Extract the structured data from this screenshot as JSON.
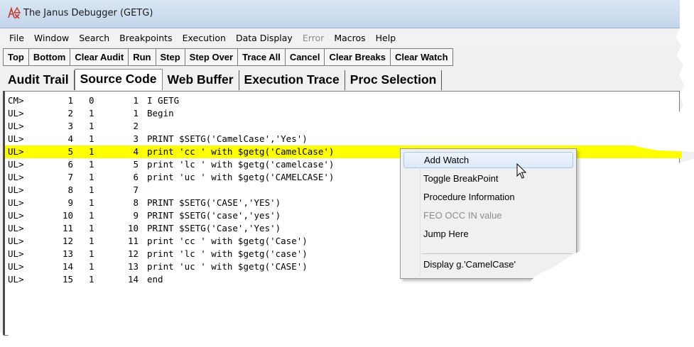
{
  "window": {
    "title": "The Janus Debugger (GETG)"
  },
  "menu": [
    "File",
    "Window",
    "Search",
    "Breakpoints",
    "Execution",
    "Data Display",
    "Error",
    "Macros",
    "Help"
  ],
  "toolbar": [
    "Top",
    "Bottom",
    "Clear Audit",
    "Run",
    "Step",
    "Step Over",
    "Trace All",
    "Cancel",
    "Clear Breaks",
    "Clear Watch"
  ],
  "tabs": [
    "Audit Trail",
    "Source Code",
    "Web Buffer",
    "Execution Trace",
    "Proc Selection"
  ],
  "active_tab": "Source Code",
  "source_lines": [
    {
      "prefix": "CM>",
      "line": "1",
      "level": "0",
      "stmt": "1",
      "code": "I GETG"
    },
    {
      "prefix": "UL>",
      "line": "2",
      "level": "1",
      "stmt": "1",
      "code": "Begin"
    },
    {
      "prefix": "UL>",
      "line": "3",
      "level": "1",
      "stmt": "2",
      "code": ""
    },
    {
      "prefix": "UL>",
      "line": "4",
      "level": "1",
      "stmt": "3",
      "code": "PRINT $SETG('CamelCase','Yes')"
    },
    {
      "prefix": "UL>",
      "line": "5",
      "level": "1",
      "stmt": "4",
      "code": "print 'cc ' with $getg('CamelCase')"
    },
    {
      "prefix": "UL>",
      "line": "6",
      "level": "1",
      "stmt": "5",
      "code": "print 'lc ' with $getg('camelcase')"
    },
    {
      "prefix": "UL>",
      "line": "7",
      "level": "1",
      "stmt": "6",
      "code": "print 'uc ' with $getg('CAMELCASE')"
    },
    {
      "prefix": "UL>",
      "line": "8",
      "level": "1",
      "stmt": "7",
      "code": ""
    },
    {
      "prefix": "UL>",
      "line": "9",
      "level": "1",
      "stmt": "8",
      "code": "PRINT $SETG('CASE','YES')"
    },
    {
      "prefix": "UL>",
      "line": "10",
      "level": "1",
      "stmt": "9",
      "code": "PRINT $SETG('case','yes')"
    },
    {
      "prefix": "UL>",
      "line": "11",
      "level": "1",
      "stmt": "10",
      "code": "PRINT $SETG('Case','Yes')"
    },
    {
      "prefix": "UL>",
      "line": "12",
      "level": "1",
      "stmt": "11",
      "code": "print 'cc ' with $getg('Case')"
    },
    {
      "prefix": "UL>",
      "line": "13",
      "level": "1",
      "stmt": "12",
      "code": "print 'lc ' with $getg('case')"
    },
    {
      "prefix": "UL>",
      "line": "14",
      "level": "1",
      "stmt": "13",
      "code": "print 'uc ' with $getg('CASE')"
    },
    {
      "prefix": "UL>",
      "line": "15",
      "level": "1",
      "stmt": "14",
      "code": "end"
    }
  ],
  "highlighted_line": "5",
  "context_menu": [
    {
      "label": "Add Watch",
      "state": "hover"
    },
    {
      "label": "Toggle BreakPoint",
      "state": "enabled"
    },
    {
      "label": "Procedure Information",
      "state": "enabled"
    },
    {
      "label": "FEO OCC IN value",
      "state": "disabled"
    },
    {
      "label": "Jump Here",
      "state": "enabled"
    },
    {
      "label": "Display g.'CamelCase'",
      "state": "enabled"
    }
  ],
  "colors": {
    "highlight": "#ffff00",
    "disabled_text": "#8d8d8d",
    "title_bar": "#c3d6ea"
  },
  "icons": {
    "app": "janus-debugger-icon",
    "cursor": "mouse-pointer-icon"
  }
}
